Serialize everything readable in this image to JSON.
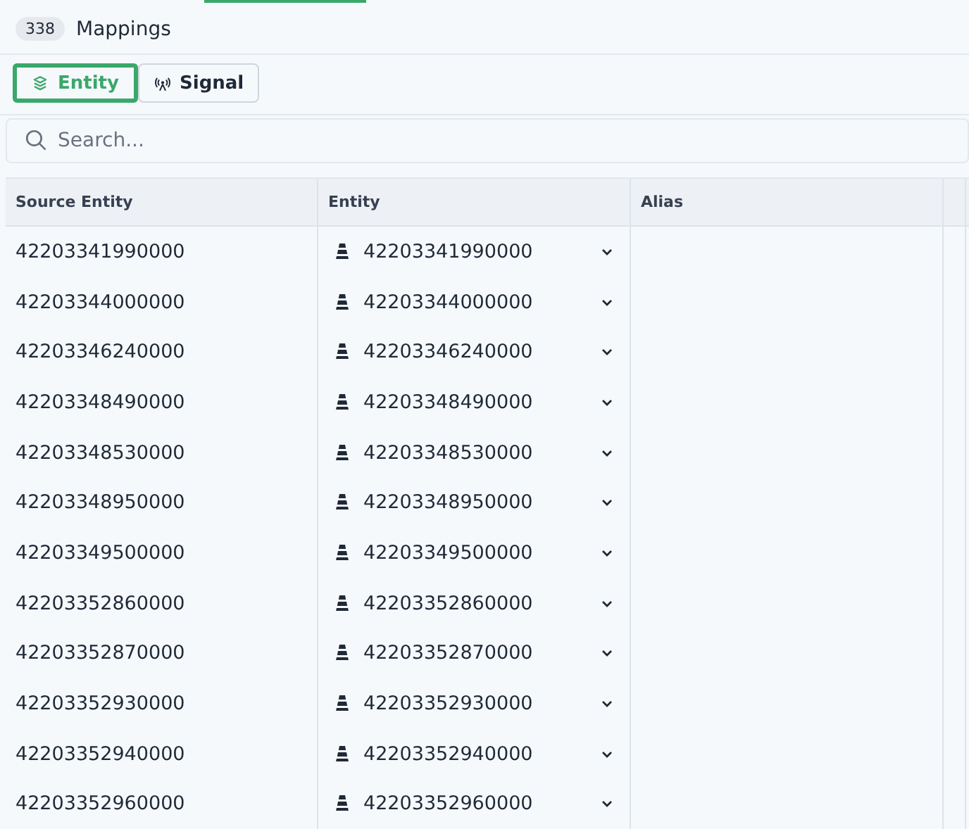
{
  "header": {
    "count": "338",
    "title": "Mappings"
  },
  "toggles": [
    {
      "label": "Entity",
      "kind": "layers",
      "selected": true
    },
    {
      "label": "Signal",
      "kind": "antenna",
      "selected": false
    }
  ],
  "search": {
    "placeholder": "Search..."
  },
  "table": {
    "columns": [
      "Source Entity",
      "Entity",
      "Alias"
    ],
    "rows": [
      {
        "source": "42203341990000",
        "entity": "42203341990000"
      },
      {
        "source": "42203344000000",
        "entity": "42203344000000"
      },
      {
        "source": "42203346240000",
        "entity": "42203346240000"
      },
      {
        "source": "42203348490000",
        "entity": "42203348490000"
      },
      {
        "source": "42203348530000",
        "entity": "42203348530000"
      },
      {
        "source": "42203348950000",
        "entity": "42203348950000"
      },
      {
        "source": "42203349500000",
        "entity": "42203349500000"
      },
      {
        "source": "42203352860000",
        "entity": "42203352860000"
      },
      {
        "source": "42203352870000",
        "entity": "42203352870000"
      },
      {
        "source": "42203352930000",
        "entity": "42203352930000"
      },
      {
        "source": "42203352940000",
        "entity": "42203352940000"
      },
      {
        "source": "42203352960000",
        "entity": "42203352960000"
      }
    ]
  }
}
